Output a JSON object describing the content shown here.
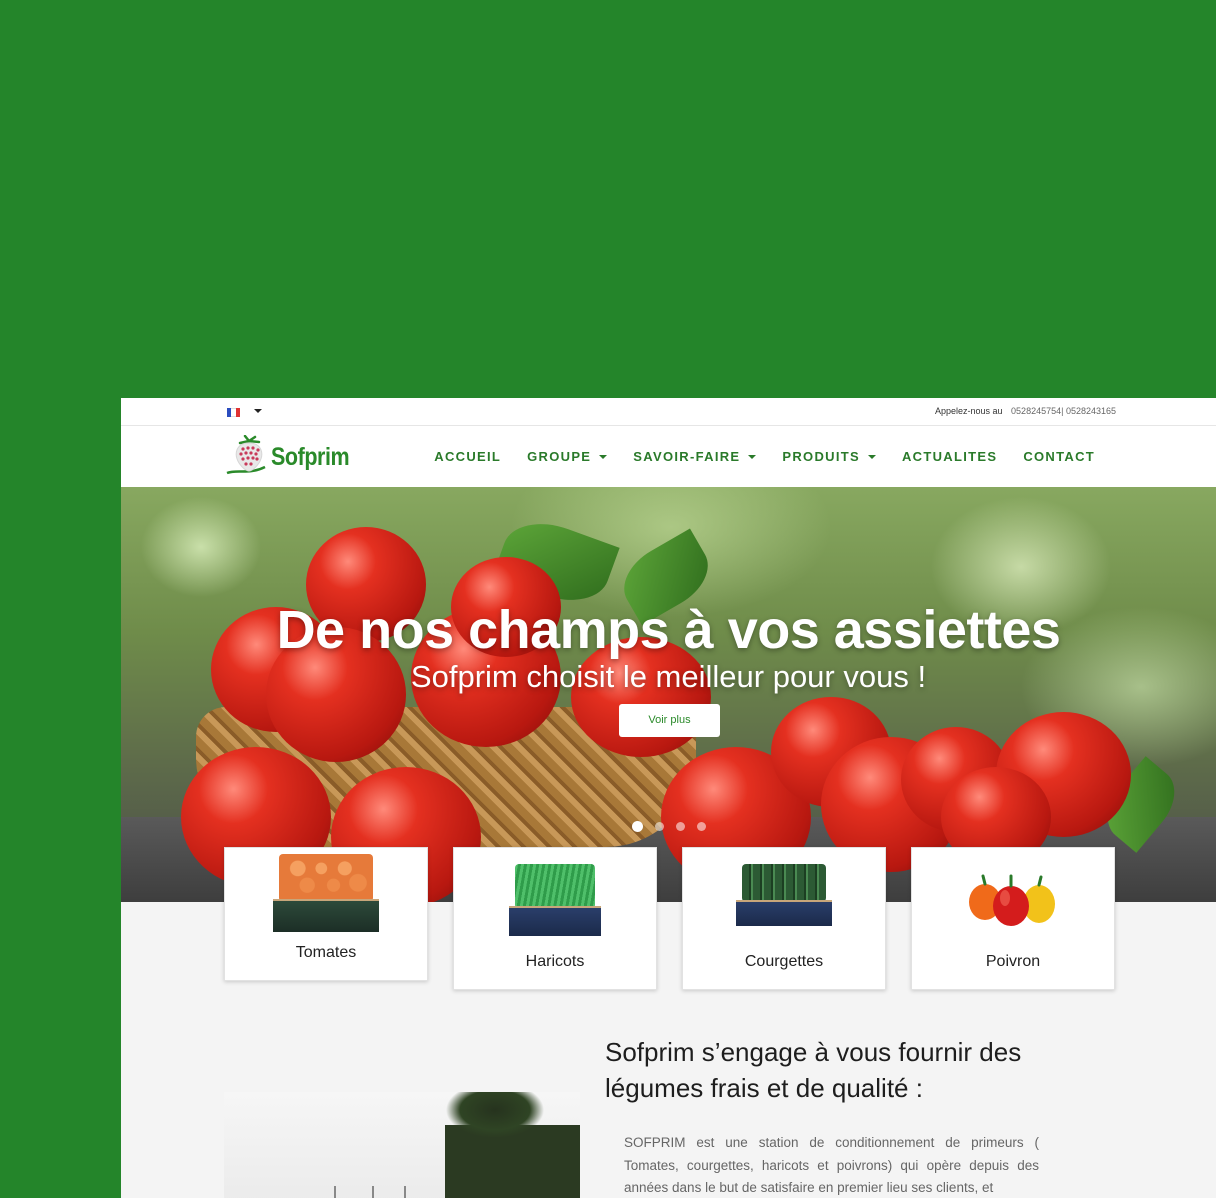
{
  "topbar": {
    "language_flag": "fr-flag-icon",
    "call_label": "Appelez-nous au",
    "phones": "0528245754| 0528243165"
  },
  "brand": {
    "name": "Sofprim",
    "logo_icon": "strawberry-logo-icon",
    "color": "#2a8a2a"
  },
  "nav": {
    "items": [
      {
        "label": "ACCUEIL",
        "dropdown": false
      },
      {
        "label": "GROUPE",
        "dropdown": true
      },
      {
        "label": "SAVOIR-FAIRE",
        "dropdown": true
      },
      {
        "label": "PRODUITS",
        "dropdown": true
      },
      {
        "label": "ACTUALITES",
        "dropdown": false
      },
      {
        "label": "CONTACT",
        "dropdown": false
      }
    ]
  },
  "hero": {
    "title": "De nos champs à vos assiettes",
    "subtitle": "Sofprim choisit le meilleur pour vous !",
    "button": "Voir plus",
    "slides": 4,
    "active_slide": 1
  },
  "products": [
    {
      "name": "Tomates",
      "icon": "tomato-crate-icon"
    },
    {
      "name": "Haricots",
      "icon": "beans-crate-icon"
    },
    {
      "name": "Courgettes",
      "icon": "zucchini-crate-icon"
    },
    {
      "name": "Poivron",
      "icon": "peppers-icon"
    }
  ],
  "about": {
    "title": "Sofprim s’engage à vous fournir des légumes frais et de qualité :",
    "text": "SOFPRIM est une station de conditionnement de primeurs ( Tomates, courgettes, haricots et poivrons) qui opère depuis des années dans le but de satisfaire en premier lieu ses clients, et"
  },
  "colors": {
    "background": "#24852a",
    "accent": "#2a7a2a"
  }
}
